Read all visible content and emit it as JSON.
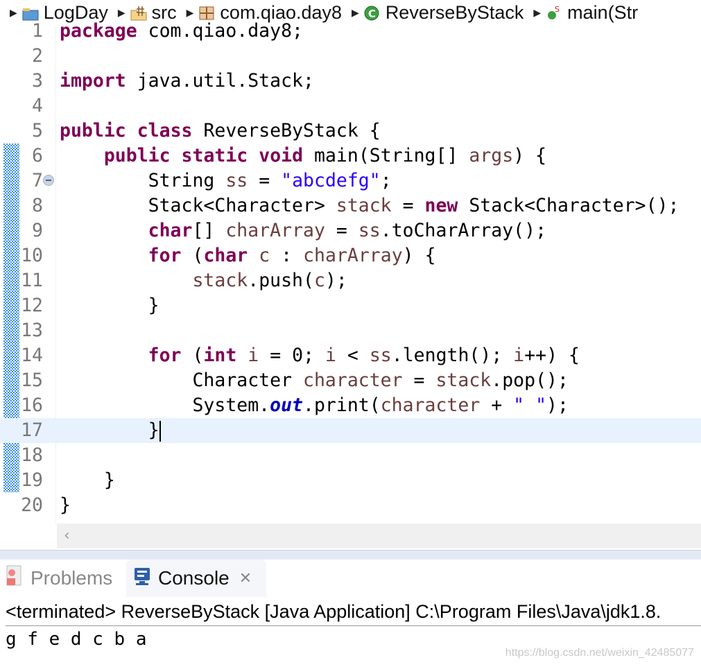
{
  "breadcrumb": [
    {
      "label": "LogDay",
      "icon": "java-project-icon"
    },
    {
      "label": "src",
      "icon": "source-folder-icon"
    },
    {
      "label": "com.qiao.day8",
      "icon": "package-icon"
    },
    {
      "label": "ReverseByStack",
      "icon": "java-class-icon"
    },
    {
      "label": "main(Str",
      "icon": "static-method-icon"
    }
  ],
  "editor": {
    "current_line": 17,
    "lines": [
      [
        [
          "kw",
          "package"
        ],
        [
          "t",
          " com.qiao.day8;"
        ]
      ],
      [],
      [
        [
          "kw",
          "import"
        ],
        [
          "t",
          " java.util.Stack;"
        ]
      ],
      [],
      [
        [
          "kw",
          "public"
        ],
        [
          "t",
          " "
        ],
        [
          "kw",
          "class"
        ],
        [
          "t",
          " ReverseByStack {"
        ]
      ],
      [
        [
          "t",
          "    "
        ],
        [
          "kw",
          "public"
        ],
        [
          "t",
          " "
        ],
        [
          "kw",
          "static"
        ],
        [
          "t",
          " "
        ],
        [
          "kw",
          "void"
        ],
        [
          "t",
          " main(String[] "
        ],
        [
          "var",
          "args"
        ],
        [
          "t",
          ") {"
        ]
      ],
      [
        [
          "t",
          "        String "
        ],
        [
          "var",
          "ss"
        ],
        [
          "t",
          " = "
        ],
        [
          "str",
          "\"abcdefg\""
        ],
        [
          "t",
          ";"
        ]
      ],
      [
        [
          "t",
          "        Stack<Character> "
        ],
        [
          "var",
          "stack"
        ],
        [
          "t",
          " = "
        ],
        [
          "kw",
          "new"
        ],
        [
          "t",
          " Stack<Character>();"
        ]
      ],
      [
        [
          "t",
          "        "
        ],
        [
          "kw",
          "char"
        ],
        [
          "t",
          "[] "
        ],
        [
          "var",
          "charArray"
        ],
        [
          "t",
          " = "
        ],
        [
          "var",
          "ss"
        ],
        [
          "t",
          ".toCharArray();"
        ]
      ],
      [
        [
          "t",
          "        "
        ],
        [
          "kw",
          "for"
        ],
        [
          "t",
          " ("
        ],
        [
          "kw",
          "char"
        ],
        [
          "t",
          " "
        ],
        [
          "var",
          "c"
        ],
        [
          "t",
          " : "
        ],
        [
          "var",
          "charArray"
        ],
        [
          "t",
          ") {"
        ]
      ],
      [
        [
          "t",
          "            "
        ],
        [
          "var",
          "stack"
        ],
        [
          "t",
          ".push("
        ],
        [
          "var",
          "c"
        ],
        [
          "t",
          ");"
        ]
      ],
      [
        [
          "t",
          "        }"
        ]
      ],
      [],
      [
        [
          "t",
          "        "
        ],
        [
          "kw",
          "for"
        ],
        [
          "t",
          " ("
        ],
        [
          "kw",
          "int"
        ],
        [
          "t",
          " "
        ],
        [
          "var",
          "i"
        ],
        [
          "t",
          " = 0; "
        ],
        [
          "var",
          "i"
        ],
        [
          "t",
          " < "
        ],
        [
          "var",
          "ss"
        ],
        [
          "t",
          ".length(); "
        ],
        [
          "var",
          "i"
        ],
        [
          "t",
          "++) {"
        ]
      ],
      [
        [
          "t",
          "            Character "
        ],
        [
          "var",
          "character"
        ],
        [
          "t",
          " = "
        ],
        [
          "var",
          "stack"
        ],
        [
          "t",
          ".pop();"
        ]
      ],
      [
        [
          "t",
          "            System."
        ],
        [
          "fld",
          "out"
        ],
        [
          "t",
          ".print("
        ],
        [
          "var",
          "character"
        ],
        [
          "t",
          " + "
        ],
        [
          "str",
          "\" \""
        ],
        [
          "t",
          ");"
        ]
      ],
      [
        [
          "t",
          "        }"
        ]
      ],
      [],
      [
        [
          "t",
          "    }"
        ]
      ],
      [
        [
          "t",
          "}"
        ]
      ]
    ],
    "scroll_left_glyph": "‹"
  },
  "panel": {
    "tabs": [
      {
        "label": "Problems",
        "icon": "problems-icon",
        "active": false
      },
      {
        "label": "Console",
        "icon": "console-icon",
        "active": true,
        "close": "✕"
      }
    ]
  },
  "console": {
    "header": "<terminated> ReverseByStack [Java Application] C:\\Program Files\\Java\\jdk1.8.",
    "output": "g f e d c b a"
  },
  "watermark": "https://blog.csdn.net/weixin_42485077",
  "colors": {
    "keyword": "#7f0055",
    "variable": "#6a3e3e",
    "string": "#2a00ff",
    "field": "#0000c0",
    "current_line": "#e8f2fe"
  }
}
